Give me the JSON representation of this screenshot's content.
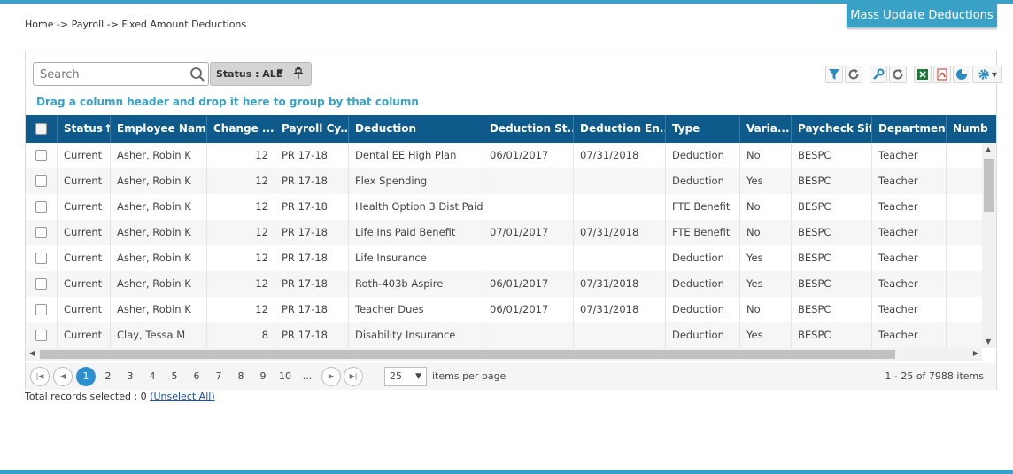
{
  "breadcrumb": "Home -> Payroll -> Fixed Amount Deductions",
  "mass_update_label": "Mass Update Deductions",
  "search": {
    "placeholder": "Search"
  },
  "status_filter": {
    "label": "Status : ALL"
  },
  "group_hint": "Drag a column header and drop it here to group by that column",
  "toolbar_icons": [
    "filter-icon",
    "refresh-icon",
    "wrench-icon",
    "refresh-icon",
    "excel-icon",
    "pdf-icon",
    "chart-icon",
    "gear-icon"
  ],
  "columns": [
    "Status",
    "Employee Name",
    "Change ...",
    "Payroll Cy...",
    "Deduction",
    "Deduction St...",
    "Deduction En...",
    "Type",
    "Varia...",
    "Paycheck Site",
    "Department",
    "Numb"
  ],
  "rows": [
    [
      "Current",
      "Asher, Robin K",
      "12",
      "PR 17-18",
      "Dental EE High Plan",
      "06/01/2017",
      "07/31/2018",
      "Deduction",
      "No",
      "BESPC",
      "Teacher"
    ],
    [
      "Current",
      "Asher, Robin K",
      "12",
      "PR 17-18",
      "Flex Spending",
      "",
      "",
      "Deduction",
      "Yes",
      "BESPC",
      "Teacher"
    ],
    [
      "Current",
      "Asher, Robin K",
      "12",
      "PR 17-18",
      "Health Option 3 Dist Paid",
      "",
      "",
      "FTE Benefit",
      "No",
      "BESPC",
      "Teacher"
    ],
    [
      "Current",
      "Asher, Robin K",
      "12",
      "PR 17-18",
      "Life Ins Paid Benefit",
      "07/01/2017",
      "07/31/2018",
      "FTE Benefit",
      "No",
      "BESPC",
      "Teacher"
    ],
    [
      "Current",
      "Asher, Robin K",
      "12",
      "PR 17-18",
      "Life Insurance",
      "",
      "",
      "Deduction",
      "Yes",
      "BESPC",
      "Teacher"
    ],
    [
      "Current",
      "Asher, Robin K",
      "12",
      "PR 17-18",
      "Roth-403b Aspire",
      "06/01/2017",
      "07/31/2018",
      "Deduction",
      "Yes",
      "BESPC",
      "Teacher"
    ],
    [
      "Current",
      "Asher, Robin K",
      "12",
      "PR 17-18",
      "Teacher Dues",
      "06/01/2017",
      "07/31/2018",
      "Deduction",
      "No",
      "BESPC",
      "Teacher"
    ],
    [
      "Current",
      "Clay, Tessa M",
      "8",
      "PR 17-18",
      "Disability Insurance",
      "",
      "",
      "Deduction",
      "Yes",
      "BESPC",
      "Teacher"
    ]
  ],
  "pager": {
    "pages": [
      "1",
      "2",
      "3",
      "4",
      "5",
      "6",
      "7",
      "8",
      "9",
      "10",
      "..."
    ],
    "current_page": "1",
    "page_size": "25",
    "items_per_page_label": "items per page",
    "info": "1 - 25 of 7988 items"
  },
  "records": {
    "label": "Total records selected : 0",
    "unselect_label": "(Unselect All)"
  },
  "colors": {
    "accent": "#3aa1c7",
    "header": "#0e5a8a",
    "active_page": "#2e8fcf"
  }
}
